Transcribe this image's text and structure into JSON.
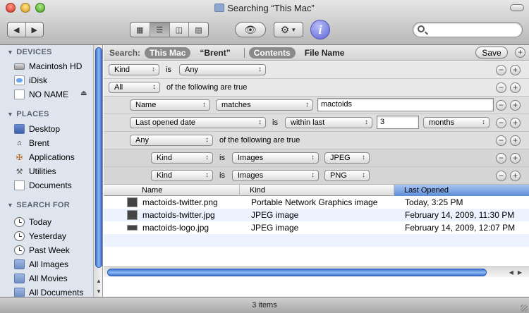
{
  "window": {
    "title": "Searching “This Mac”"
  },
  "toolbar": {
    "back_icon": "back-arrow-icon",
    "forward_icon": "forward-arrow-icon",
    "views": [
      "icon-view",
      "list-view",
      "column-view",
      "coverflow-view"
    ],
    "active_view": "list-view",
    "quicklook_icon": "eye-icon",
    "action_icon": "gear-icon",
    "info_label": "i",
    "search_value": ""
  },
  "sidebar": {
    "devices_heading": "DEVICES",
    "devices": [
      {
        "label": "Macintosh HD",
        "icon": "hard-disk-icon"
      },
      {
        "label": "iDisk",
        "icon": "idisk-icon"
      },
      {
        "label": "NO NAME",
        "icon": "disk-icon",
        "eject": "⏏"
      }
    ],
    "places_heading": "PLACES",
    "places": [
      {
        "label": "Desktop",
        "icon": "desktop-icon"
      },
      {
        "label": "Brent",
        "icon": "home-icon"
      },
      {
        "label": "Applications",
        "icon": "applications-icon"
      },
      {
        "label": "Utilities",
        "icon": "utilities-icon"
      },
      {
        "label": "Documents",
        "icon": "documents-icon"
      }
    ],
    "search_heading": "SEARCH FOR",
    "searches": [
      {
        "label": "Today",
        "icon": "clock-icon"
      },
      {
        "label": "Yesterday",
        "icon": "clock-icon"
      },
      {
        "label": "Past Week",
        "icon": "clock-icon"
      },
      {
        "label": "All Images",
        "icon": "smart-folder-icon"
      },
      {
        "label": "All Movies",
        "icon": "smart-folder-icon"
      },
      {
        "label": "All Documents",
        "icon": "smart-folder-icon"
      }
    ]
  },
  "search_bar": {
    "label": "Search:",
    "scope_this_mac": "This Mac",
    "scope_brent": "“Brent”",
    "contents": "Contents",
    "file_name": "File Name",
    "save_label": "Save"
  },
  "criteria": {
    "r1": {
      "attr": "Kind",
      "is": "is",
      "value": "Any"
    },
    "r2": {
      "match": "All",
      "text": "of the following are true"
    },
    "r3": {
      "attr": "Name",
      "op": "matches",
      "value": "mactoids"
    },
    "r4": {
      "attr": "Last opened date",
      "is": "is",
      "op": "within last",
      "value": "3",
      "unit": "months"
    },
    "r5": {
      "match": "Any",
      "text": "of the following are true"
    },
    "r6": {
      "attr": "Kind",
      "is": "is",
      "value": "Images",
      "sub": "JPEG"
    },
    "r7": {
      "attr": "Kind",
      "is": "is",
      "value": "Images",
      "sub": "PNG"
    },
    "minus": "−",
    "plus": "+"
  },
  "list": {
    "columns": [
      "Name",
      "Kind",
      "Last Opened"
    ],
    "sorted_column": "Last Opened",
    "rows": [
      {
        "name": "mactoids-twitter.png",
        "kind": "Portable Network Graphics image",
        "opened": "Today, 3:25 PM"
      },
      {
        "name": "mactoids-twitter.jpg",
        "kind": "JPEG image",
        "opened": "February 14, 2009, 11:30 PM"
      },
      {
        "name": "mactoids-logo.jpg",
        "kind": "JPEG image",
        "opened": "February 14, 2009, 12:07 PM"
      }
    ]
  },
  "status": {
    "text": "3 items"
  }
}
